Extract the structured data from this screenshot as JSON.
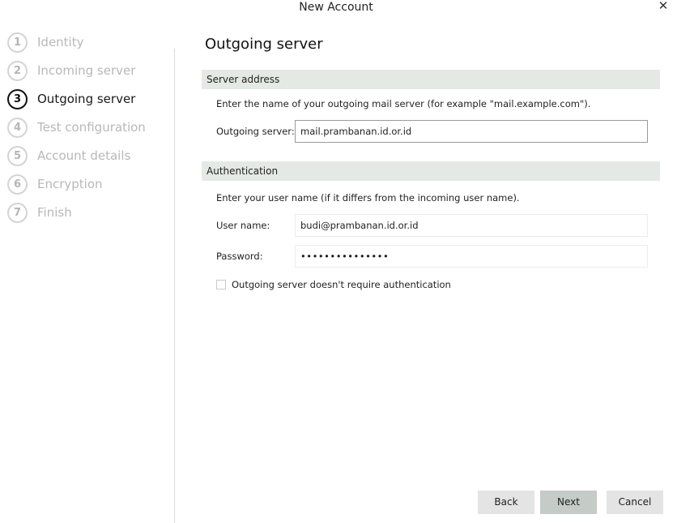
{
  "window": {
    "title": "New Account",
    "close_icon": "close-icon"
  },
  "steps": [
    {
      "number": "1",
      "label": "Identity",
      "state": "inactive"
    },
    {
      "number": "2",
      "label": "Incoming server",
      "state": "inactive"
    },
    {
      "number": "3",
      "label": "Outgoing server",
      "state": "active"
    },
    {
      "number": "4",
      "label": "Test configuration",
      "state": "inactive"
    },
    {
      "number": "5",
      "label": "Account details",
      "state": "inactive"
    },
    {
      "number": "6",
      "label": "Encryption",
      "state": "inactive"
    },
    {
      "number": "7",
      "label": "Finish",
      "state": "inactive"
    }
  ],
  "page": {
    "title": "Outgoing server"
  },
  "server_section": {
    "header": "Server address",
    "description": "Enter the name of your outgoing mail server (for example \"mail.example.com\").",
    "server_label": "Outgoing server:",
    "server_value": "mail.prambanan.id.or.id"
  },
  "auth_section": {
    "header": "Authentication",
    "description": "Enter your user name (if it differs from the incoming user name).",
    "username_label": "User name:",
    "username_value": "budi@prambanan.id.or.id",
    "password_label": "Password:",
    "password_value": "•••••••••••••••",
    "no_auth_label": "Outgoing server doesn't require authentication",
    "no_auth_checked": false
  },
  "buttons": {
    "back": "Back",
    "next": "Next",
    "cancel": "Cancel"
  },
  "colors": {
    "section_header_bg": "#e5e9e6",
    "primary_button_bg": "#c5cbc7",
    "button_bg": "#e4e4e4",
    "inactive_step": "#b8b8b8"
  }
}
